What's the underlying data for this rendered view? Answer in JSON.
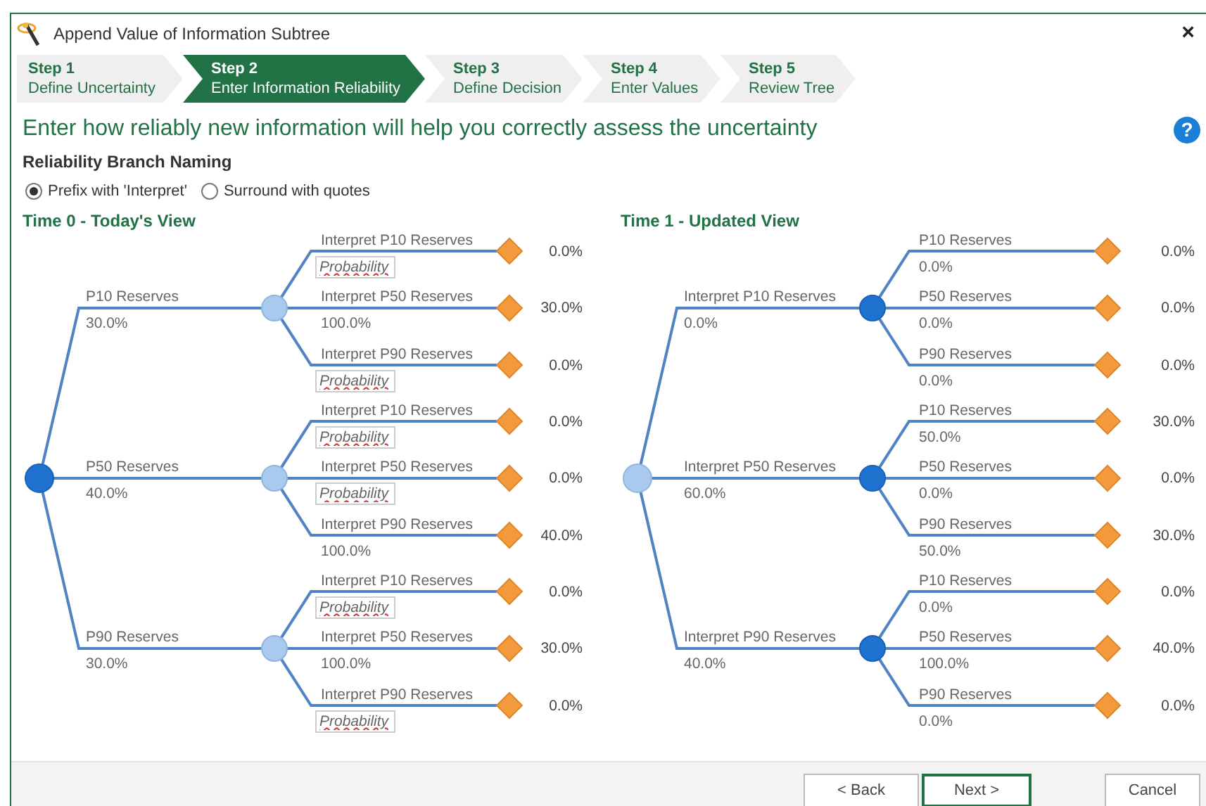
{
  "window": {
    "title": "Append Value of Information Subtree",
    "close": "×"
  },
  "steps": [
    {
      "label": "Step 1",
      "caption": "Define Uncertainty",
      "selected": false
    },
    {
      "label": "Step 2",
      "caption": "Enter Information Reliability",
      "selected": true
    },
    {
      "label": "Step 3",
      "caption": "Define Decision",
      "selected": false
    },
    {
      "label": "Step 4",
      "caption": "Enter Values",
      "selected": false
    },
    {
      "label": "Step 5",
      "caption": "Review Tree",
      "selected": false
    }
  ],
  "heading": "Enter how reliably new information will help you correctly assess the uncertainty",
  "help": "?",
  "naming": {
    "label": "Reliability Branch Naming",
    "options": [
      {
        "label": "Prefix with 'Interpret'",
        "selected": true
      },
      {
        "label": "Surround with quotes",
        "selected": false
      }
    ]
  },
  "trees": [
    {
      "title": "Time 0 - Today's View",
      "root_highlighted": true,
      "branches": [
        {
          "label": "P10 Reserves",
          "value": "30.0%",
          "node_highlighted": false,
          "outcomes": [
            {
              "label": "Interpret P10 Reserves",
              "kind": "field",
              "placeholder": "Probability",
              "payoff": "0.0%"
            },
            {
              "label": "Interpret P50 Reserves",
              "kind": "text",
              "value": "100.0%",
              "payoff": "30.0%"
            },
            {
              "label": "Interpret P90 Reserves",
              "kind": "field",
              "placeholder": "Probability",
              "payoff": "0.0%"
            }
          ]
        },
        {
          "label": "P50 Reserves",
          "value": "40.0%",
          "node_highlighted": false,
          "outcomes": [
            {
              "label": "Interpret P10 Reserves",
              "kind": "field",
              "placeholder": "Probability",
              "payoff": "0.0%"
            },
            {
              "label": "Interpret P50 Reserves",
              "kind": "field",
              "placeholder": "Probability",
              "payoff": "0.0%"
            },
            {
              "label": "Interpret P90 Reserves",
              "kind": "text",
              "value": "100.0%",
              "payoff": "40.0%"
            }
          ]
        },
        {
          "label": "P90 Reserves",
          "value": "30.0%",
          "node_highlighted": false,
          "outcomes": [
            {
              "label": "Interpret P10 Reserves",
              "kind": "field",
              "placeholder": "Probability",
              "payoff": "0.0%"
            },
            {
              "label": "Interpret P50 Reserves",
              "kind": "text",
              "value": "100.0%",
              "payoff": "30.0%"
            },
            {
              "label": "Interpret P90 Reserves",
              "kind": "field",
              "placeholder": "Probability",
              "payoff": "0.0%"
            }
          ]
        }
      ]
    },
    {
      "title": "Time 1 - Updated View",
      "root_highlighted": false,
      "branches": [
        {
          "label": "Interpret P10 Reserves",
          "value": "0.0%",
          "node_highlighted": true,
          "outcomes": [
            {
              "label": "P10 Reserves",
              "kind": "text",
              "value": "0.0%",
              "payoff": "0.0%"
            },
            {
              "label": "P50 Reserves",
              "kind": "text",
              "value": "0.0%",
              "payoff": "0.0%"
            },
            {
              "label": "P90 Reserves",
              "kind": "text",
              "value": "0.0%",
              "payoff": "0.0%"
            }
          ]
        },
        {
          "label": "Interpret P50 Reserves",
          "value": "60.0%",
          "node_highlighted": true,
          "outcomes": [
            {
              "label": "P10 Reserves",
              "kind": "text",
              "value": "50.0%",
              "payoff": "30.0%"
            },
            {
              "label": "P50 Reserves",
              "kind": "text",
              "value": "0.0%",
              "payoff": "0.0%"
            },
            {
              "label": "P90 Reserves",
              "kind": "text",
              "value": "50.0%",
              "payoff": "30.0%"
            }
          ]
        },
        {
          "label": "Interpret P90 Reserves",
          "value": "40.0%",
          "node_highlighted": true,
          "outcomes": [
            {
              "label": "P10 Reserves",
              "kind": "text",
              "value": "0.0%",
              "payoff": "0.0%"
            },
            {
              "label": "P50 Reserves",
              "kind": "text",
              "value": "100.0%",
              "payoff": "40.0%"
            },
            {
              "label": "P90 Reserves",
              "kind": "text",
              "value": "0.0%",
              "payoff": "0.0%"
            }
          ]
        }
      ]
    }
  ],
  "buttons": [
    {
      "label": "< Back",
      "default": false
    },
    {
      "label": "Next >",
      "default": true
    },
    {
      "label": "Cancel",
      "default": false
    }
  ]
}
